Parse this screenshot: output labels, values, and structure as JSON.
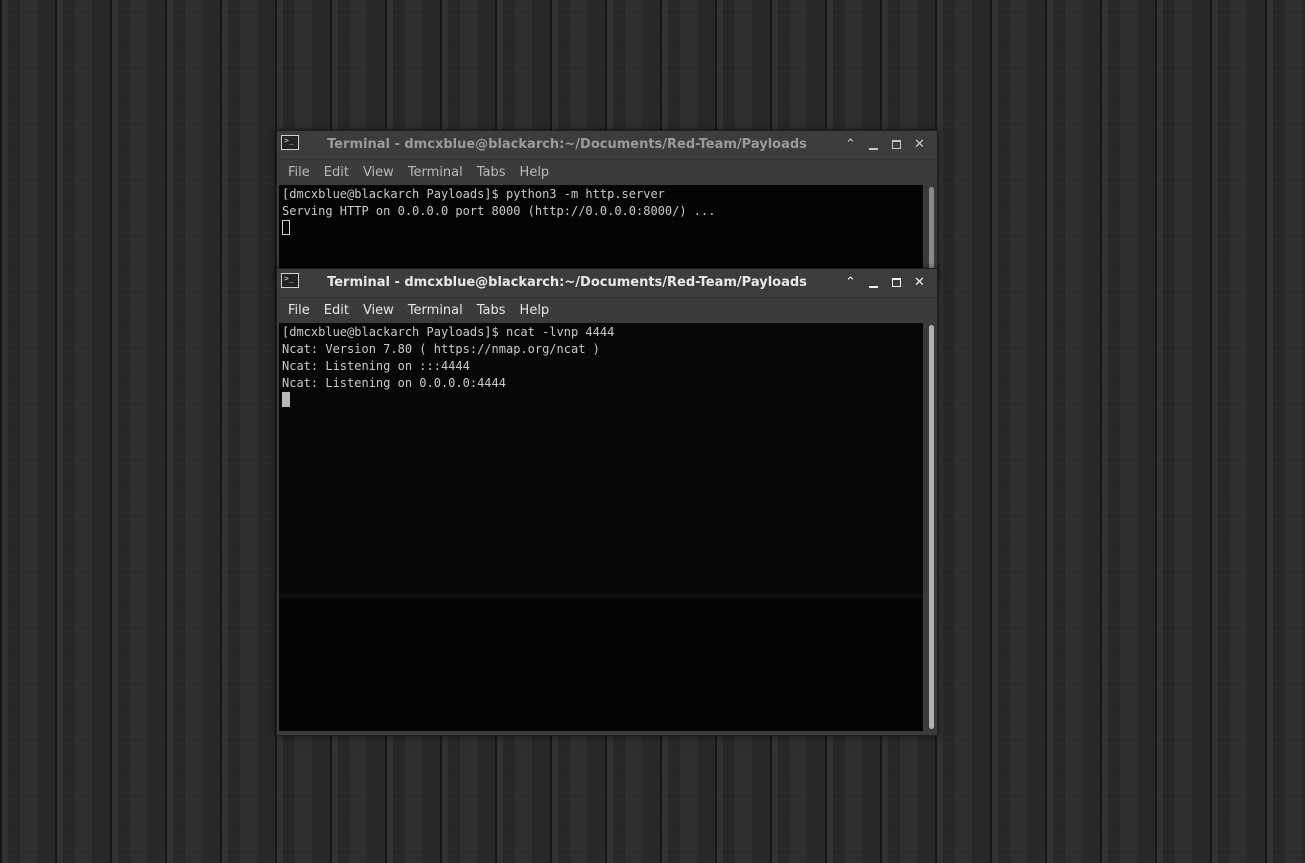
{
  "back_window": {
    "title": "Terminal - dmcxblue@blackarch:~/Documents/Red-Team/Payloads",
    "icon": "terminal-icon",
    "controls": {
      "shade": "⌃",
      "minimize": "minimize-icon",
      "maximize": "maximize-icon",
      "close": "✕"
    },
    "menu": [
      "File",
      "Edit",
      "View",
      "Terminal",
      "Tabs",
      "Help"
    ],
    "lines": [
      "[dmcxblue@blackarch Payloads]$ python3 -m http.server",
      "Serving HTTP on 0.0.0.0 port 8000 (http://0.0.0.0:8000/) ..."
    ]
  },
  "front_window": {
    "title": "Terminal - dmcxblue@blackarch:~/Documents/Red-Team/Payloads",
    "icon": "terminal-icon",
    "controls": {
      "shade": "⌃",
      "minimize": "minimize-icon",
      "maximize": "maximize-icon",
      "close": "✕"
    },
    "menu": [
      "File",
      "Edit",
      "View",
      "Terminal",
      "Tabs",
      "Help"
    ],
    "lines": [
      "[dmcxblue@blackarch Payloads]$ ncat -lvnp 4444",
      "Ncat: Version 7.80 ( https://nmap.org/ncat )",
      "Ncat: Listening on :::4444",
      "Ncat: Listening on 0.0.0.0:4444"
    ]
  },
  "colors": {
    "terminal_bg": "#050505",
    "terminal_fg": "#c9c9c9",
    "window_chrome": "#3b3b3b"
  }
}
